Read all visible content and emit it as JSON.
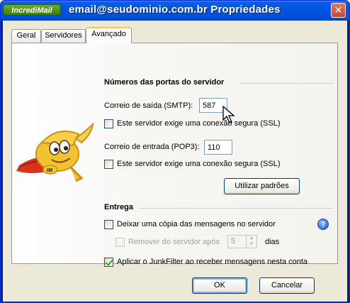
{
  "window": {
    "brand": "IncrediMail",
    "title": "email@seudominio.com.br Propriedades",
    "close_label": "✕"
  },
  "tabs": [
    {
      "label": "Geral",
      "active": false
    },
    {
      "label": "Servidores",
      "active": false
    },
    {
      "label": "Avançado",
      "active": true
    }
  ],
  "ports": {
    "heading": "Números das portas do servidor",
    "outgoing_label": "Correio de saída (SMTP):",
    "outgoing_value": "587",
    "outgoing_ssl_label": "Este servidor exige uma conexão segura (SSL)",
    "outgoing_ssl_checked": false,
    "incoming_label": "Correio de entrada (POP3):",
    "incoming_value": "110",
    "incoming_ssl_label": "Este servidor exige uma conexão segura (SSL)",
    "incoming_ssl_checked": false,
    "defaults_button": "Utilizar padrões"
  },
  "delivery": {
    "heading": "Entrega",
    "leave_copy_label": "Deixar uma cópia das mensagens no servidor",
    "leave_copy_checked": false,
    "remove_after_label": "Remover do servidor após",
    "remove_after_value": "5",
    "days_label": "dias",
    "junkfilter_label": "Aplicar o JunkFilter ao receber mensagens nesta conta",
    "junkfilter_checked": true,
    "help_label": "?"
  },
  "footer": {
    "ok_label": "OK",
    "cancel_label": "Cancelar"
  },
  "colors": {
    "titlebar": "#0054e3",
    "brand": "#6fae2c",
    "client": "#ece9d8",
    "input_border": "#7f9db9"
  }
}
